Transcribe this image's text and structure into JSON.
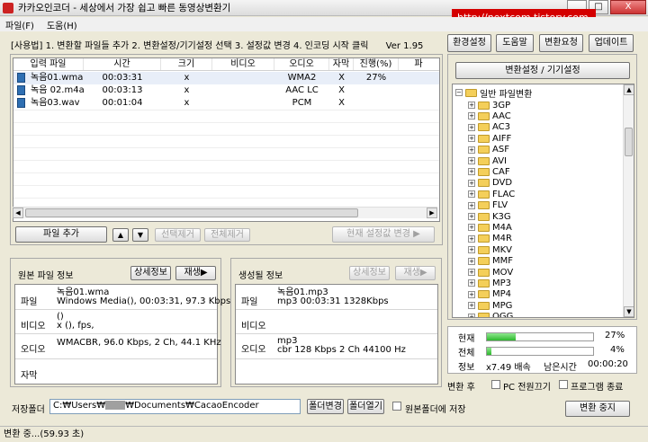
{
  "window": {
    "title": "카카오인코더 - 세상에서 가장 쉽고 빠른 동영상변환기",
    "overlay_url": "http://nextcom.tistory.com",
    "min": "_",
    "max": "□",
    "close": "X"
  },
  "menu": {
    "items": [
      "파일(F)",
      "도움(H)"
    ]
  },
  "usage": {
    "text": "[사용법] 1. 변환할 파일들 추가   2. 변환설정/기기설정 선택   3. 설정값 변경   4. 인코딩 시작 클릭",
    "version": "Ver 1.95"
  },
  "top_buttons": {
    "env": "환경설정",
    "help": "도움말",
    "request": "변환요청",
    "update": "업데이트"
  },
  "filelist": {
    "columns": [
      "입력 파일",
      "시간",
      "크기",
      "비디오",
      "오디오",
      "자막",
      "진행(%)",
      "파"
    ],
    "rows": [
      {
        "icon": "audio-file-icon",
        "name": "녹음01.wma",
        "time": "00:03:31",
        "size": "x",
        "video": "",
        "audio": "WMA2",
        "sub": "X",
        "progress": "27%"
      },
      {
        "icon": "audio-file-icon",
        "name": "녹음 02.m4a",
        "time": "00:03:13",
        "size": "x",
        "video": "",
        "audio": "AAC LC",
        "sub": "X",
        "progress": ""
      },
      {
        "icon": "audio-file-icon",
        "name": "녹음03.wav",
        "time": "00:01:04",
        "size": "x",
        "video": "",
        "audio": "PCM",
        "sub": "X",
        "progress": ""
      }
    ]
  },
  "list_buttons": {
    "add": "파일 추가",
    "up": "▲",
    "down": "▼",
    "remove_sel": "선택제거",
    "remove_all": "전체제거",
    "apply": "현재 설정값 변경 ▶"
  },
  "source_info": {
    "title": "원본 파일 정보",
    "detail": "상세정보",
    "play": "재생▶",
    "file_label": "파일",
    "file_val1": "녹음01.wma",
    "file_val2": "Windows Media(), 00:03:31, 97.3 Kbps",
    "video_label": "비디오",
    "video_val1": "()",
    "video_val2": "x (),  fps,",
    "audio_label": "오디오",
    "audio_val": "WMACBR, 96.0 Kbps, 2 Ch, 44.1 KHz",
    "sub_label": "자막"
  },
  "output_info": {
    "title": "생성될 정보",
    "detail": "상세정보",
    "play": "재생▶",
    "file_label": "파일",
    "file_val1": "녹음01.mp3",
    "file_val2": "mp3   00:03:31   1328Kbps",
    "video_label": "비디오",
    "audio_label": "오디오",
    "audio_val1": "mp3",
    "audio_val2": "cbr     128 Kbps   2 Ch   44100 Hz"
  },
  "settings": {
    "header_button": "변환설정 / 기기설정",
    "root": "일반 파일변환",
    "items": [
      "3GP",
      "AAC",
      "AC3",
      "AIFF",
      "ASF",
      "AVI",
      "CAF",
      "DVD",
      "FLAC",
      "FLV",
      "K3G",
      "M4A",
      "M4R",
      "MKV",
      "MMF",
      "MOV",
      "MP3",
      "MP4",
      "MPG",
      "OGG"
    ]
  },
  "progress": {
    "current_label": "현재",
    "current_value": 0.27,
    "current_pct": "27%",
    "total_label": "전체",
    "total_value": 0.04,
    "total_pct": "4%",
    "info_label": "정보",
    "speed": "x7.49 배속",
    "remain_label": "남은시간",
    "remain": "00:00:20"
  },
  "after": {
    "label": "변환 후",
    "power_off": "PC 전원끄기",
    "exit": "프로그램 종료"
  },
  "save": {
    "label": "저장폴더",
    "path_prefix": "C:₩Users₩",
    "path_suffix": "₩Documents₩CacaoEncoder",
    "change": "폴더변경",
    "open": "폴더열기",
    "same": "원본폴더에 저장"
  },
  "stop_button": "변환 중지",
  "status": "변환 중...(59.93 초)",
  "colors": {
    "bg": "#ece9d8",
    "progress": "#2db82d",
    "overlay": "#d40000"
  }
}
